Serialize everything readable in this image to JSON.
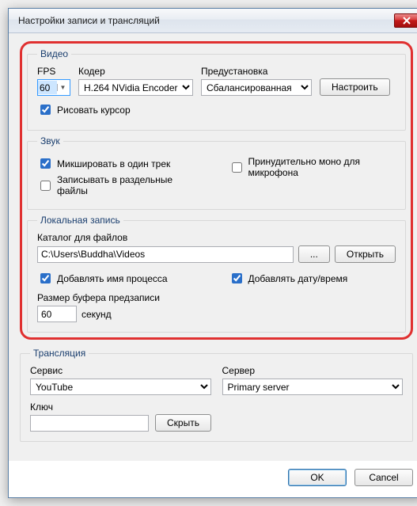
{
  "window": {
    "title": "Настройки записи и трансляций"
  },
  "video": {
    "legend": "Видео",
    "fps_label": "FPS",
    "fps_value": "60",
    "coder_label": "Кодер",
    "coder_value": "H.264 NVidia Encoder",
    "preset_label": "Предустановка",
    "preset_value": "Сбалансированная",
    "configure_btn": "Настроить",
    "draw_cursor": "Рисовать курсор"
  },
  "sound": {
    "legend": "Звук",
    "mix_one": "Микшировать в один трек",
    "force_mono": "Принудительно моно для микрофона",
    "split_files": "Записывать в раздельные файлы"
  },
  "local": {
    "legend": "Локальная запись",
    "folder_label": "Каталог для файлов",
    "folder_value": "C:\\Users\\Buddha\\Videos",
    "browse": "...",
    "open": "Открыть",
    "add_proc_name": "Добавлять имя процесса",
    "add_datetime": "Добавлять дату/время",
    "buffer_label": "Размер буфера предзаписи",
    "buffer_value": "60",
    "buffer_unit": "секунд"
  },
  "stream": {
    "legend": "Трансляция",
    "service_label": "Сервис",
    "service_value": "YouTube",
    "server_label": "Сервер",
    "server_value": "Primary server",
    "key_label": "Ключ",
    "key_value": "",
    "hide_btn": "Скрыть"
  },
  "footer": {
    "ok": "OK",
    "cancel": "Cancel"
  }
}
